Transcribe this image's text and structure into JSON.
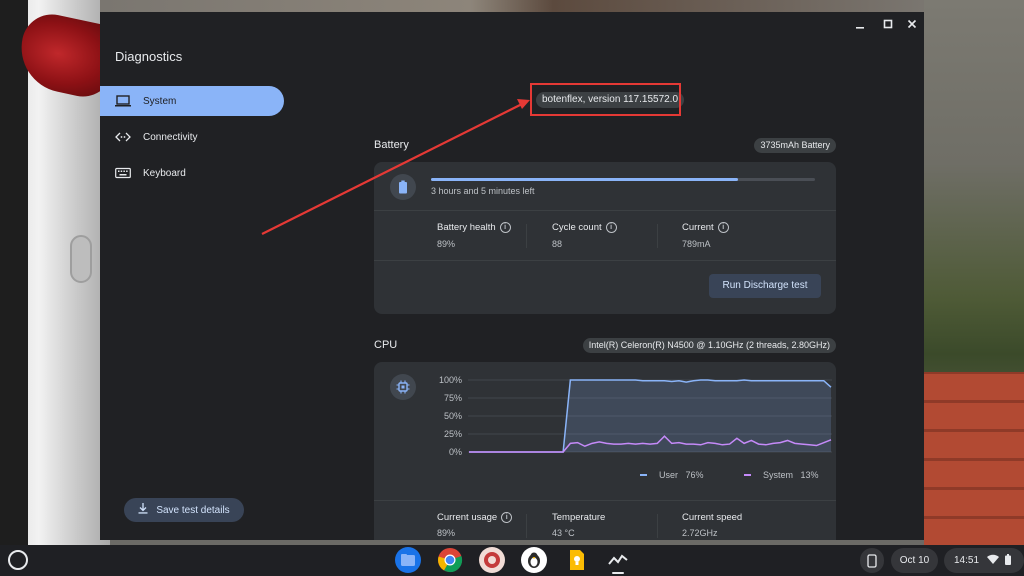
{
  "app": {
    "title": "Diagnostics",
    "window_controls": [
      "minimize",
      "maximize",
      "close"
    ]
  },
  "nav": {
    "items": [
      {
        "label": "System",
        "icon": "laptop-icon",
        "active": true
      },
      {
        "label": "Connectivity",
        "icon": "connectivity-icon",
        "active": false
      },
      {
        "label": "Keyboard",
        "icon": "keyboard-icon",
        "active": false
      }
    ],
    "save_label": "Save test details"
  },
  "version_label": "botenflex, version 117.15572.0",
  "battery": {
    "title": "Battery",
    "chip": "3735mAh Battery",
    "time_left": "3 hours and 5 minutes left",
    "charge_fraction": 0.8,
    "stats": [
      {
        "label": "Battery health",
        "value": "89%"
      },
      {
        "label": "Cycle count",
        "value": "88"
      },
      {
        "label": "Current",
        "value": "789mA"
      }
    ],
    "run_label": "Run Discharge test"
  },
  "cpu": {
    "title": "CPU",
    "chip": "Intel(R) Celeron(R) N4500 @ 1.10GHz (2 threads, 2.80GHz)",
    "y_ticks": [
      "100%",
      "75%",
      "50%",
      "25%",
      "0%"
    ],
    "legend": [
      {
        "label": "User",
        "value": "76%",
        "color": "#8ab4f8"
      },
      {
        "label": "System",
        "value": "13%",
        "color": "#c58af9"
      }
    ],
    "stats": [
      {
        "label": "Current usage",
        "value": "89%"
      },
      {
        "label": "Temperature",
        "value": "43 °C"
      },
      {
        "label": "Current speed",
        "value": "2.72GHz"
      }
    ]
  },
  "chart_data": {
    "type": "area",
    "title": "",
    "xlabel": "",
    "ylabel": "",
    "ylim": [
      0,
      100
    ],
    "x": [
      0,
      1,
      2,
      3,
      4,
      5,
      6,
      7,
      8,
      9,
      10,
      11,
      12,
      13,
      14,
      15,
      16,
      17,
      18,
      19,
      20,
      21,
      22,
      23,
      24,
      25,
      26,
      27,
      28,
      29,
      30,
      31,
      32,
      33,
      34,
      35,
      36,
      37,
      38,
      39,
      40,
      41,
      42,
      43,
      44,
      45,
      46,
      47,
      48,
      49,
      50
    ],
    "series": [
      {
        "name": "User",
        "values": [
          0,
          0,
          0,
          0,
          0,
          0,
          0,
          0,
          0,
          0,
          0,
          0,
          0,
          0,
          100,
          100,
          100,
          100,
          100,
          100,
          100,
          100,
          100,
          100,
          99,
          99,
          99,
          99,
          98,
          99,
          97,
          99,
          100,
          100,
          99,
          99,
          99,
          99,
          100,
          99,
          99,
          99,
          99,
          99,
          99,
          99,
          99,
          99,
          99,
          99,
          90
        ]
      },
      {
        "name": "System",
        "values": [
          0,
          0,
          0,
          0,
          0,
          0,
          0,
          0,
          0,
          0,
          0,
          0,
          0,
          0,
          12,
          13,
          8,
          12,
          14,
          12,
          11,
          11,
          12,
          11,
          12,
          11,
          12,
          22,
          12,
          13,
          11,
          11,
          10,
          13,
          12,
          10,
          11,
          19,
          12,
          16,
          11,
          10,
          12,
          13,
          16,
          12,
          11,
          10,
          9,
          13,
          17
        ]
      }
    ]
  },
  "shelf": {
    "date": "Oct 10",
    "time": "14:51",
    "apps": [
      "files-icon",
      "chrome-icon",
      "app-icon",
      "app-icon",
      "keep-icon",
      "diagnostics-icon"
    ]
  }
}
